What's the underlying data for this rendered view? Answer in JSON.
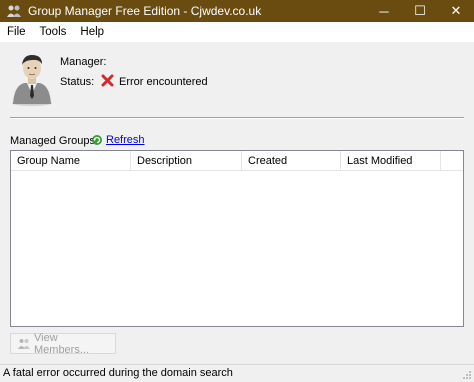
{
  "window": {
    "title": "Group Manager Free Edition - Cjwdev.co.uk",
    "title_bar_color": "#6b4c10",
    "controls": {
      "minimize": "─",
      "maximize": "☐",
      "close": "✕"
    }
  },
  "menu": {
    "items": [
      "File",
      "Tools",
      "Help"
    ]
  },
  "info": {
    "manager_label": "Manager:",
    "manager_value": "",
    "status_label": "Status:",
    "status_value": "Error encountered",
    "status_icon": "error-x-icon",
    "status_color": "#d9272e"
  },
  "groups": {
    "label": "Managed Groups",
    "refresh_label": "Refresh",
    "columns": [
      "Group Name",
      "Description",
      "Created",
      "Last Modified"
    ],
    "rows": []
  },
  "buttons": {
    "view_members": "View Members..."
  },
  "statusbar": {
    "text": "A fatal error occurred during the domain search"
  }
}
